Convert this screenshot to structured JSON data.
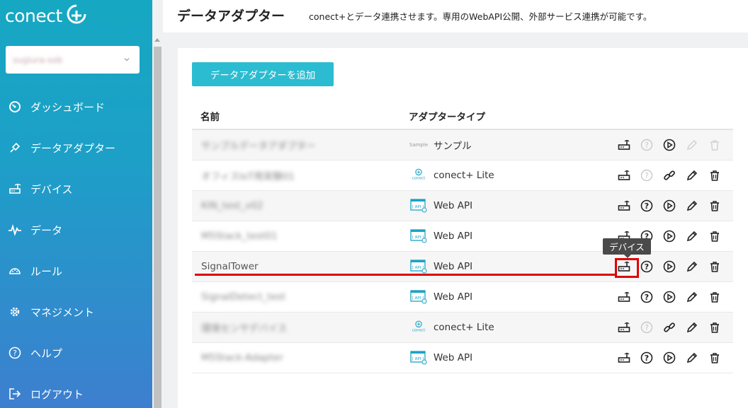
{
  "brand": {
    "logo_text": "conect"
  },
  "account": {
    "name": "sugiura-sob"
  },
  "nav": {
    "items": [
      {
        "label": "ダッシュボード",
        "icon": "dashboard-icon"
      },
      {
        "label": "データアダプター",
        "icon": "plug-icon"
      },
      {
        "label": "デバイス",
        "icon": "router-icon"
      },
      {
        "label": "データ",
        "icon": "pulse-icon"
      },
      {
        "label": "ルール",
        "icon": "rule-icon"
      },
      {
        "label": "マネジメント",
        "icon": "gear-icon"
      },
      {
        "label": "ヘルプ",
        "icon": "help-icon"
      },
      {
        "label": "ログアウト",
        "icon": "logout-icon"
      }
    ]
  },
  "header": {
    "title": "データアダプター",
    "description": "conect+とデータ連携させます。専用のWebAPI公開、外部サービス連携が可能です。"
  },
  "main": {
    "add_button": "データアダプターを追加",
    "columns": {
      "name": "名前",
      "type": "アダプタータイプ"
    },
    "rows": [
      {
        "name": "サンプルデータアダプター",
        "type": "サンプル",
        "type_icon": "sample",
        "type_icon_label": "Sample",
        "blurred": true,
        "actions": [
          "device",
          "help-disabled",
          "play",
          "edit-disabled",
          "delete-disabled"
        ]
      },
      {
        "name": "オフィスIoT用実験01",
        "type": "conect+ Lite",
        "type_icon": "conect",
        "blurred": true,
        "actions": [
          "device",
          "help-disabled",
          "link",
          "edit",
          "delete"
        ]
      },
      {
        "name": "KIN_test_v02",
        "type": "Web API",
        "type_icon": "api",
        "blurred": true,
        "actions": [
          "device",
          "help",
          "play",
          "edit",
          "delete"
        ]
      },
      {
        "name": "M5Stack_test01",
        "type": "Web API",
        "type_icon": "api",
        "blurred": true,
        "actions": [
          "device",
          "help",
          "play",
          "edit",
          "delete"
        ]
      },
      {
        "name": "SignalTower",
        "type": "Web API",
        "type_icon": "api",
        "blurred": false,
        "actions": [
          "device",
          "help",
          "play",
          "edit",
          "delete"
        ]
      },
      {
        "name": "SignalDetect_test",
        "type": "Web API",
        "type_icon": "api",
        "blurred": true,
        "actions": [
          "device",
          "help",
          "play",
          "edit",
          "delete"
        ]
      },
      {
        "name": "環境センサデバイス",
        "type": "conect+ Lite",
        "type_icon": "conect",
        "blurred": true,
        "actions": [
          "device",
          "help-disabled",
          "link",
          "edit",
          "delete"
        ]
      },
      {
        "name": "M5Stack-Adapter",
        "type": "Web API",
        "type_icon": "api",
        "blurred": true,
        "actions": [
          "device",
          "help",
          "play",
          "edit",
          "delete"
        ]
      }
    ],
    "api_icon_label": "[ API ]",
    "conect_icon_label": "conect"
  },
  "tooltip": {
    "text": "デバイス"
  },
  "colors": {
    "accent": "#2bbcd1",
    "sidebar_top": "#16a8c2",
    "sidebar_bottom": "#3d7fcf",
    "annotation": "#e00000"
  }
}
